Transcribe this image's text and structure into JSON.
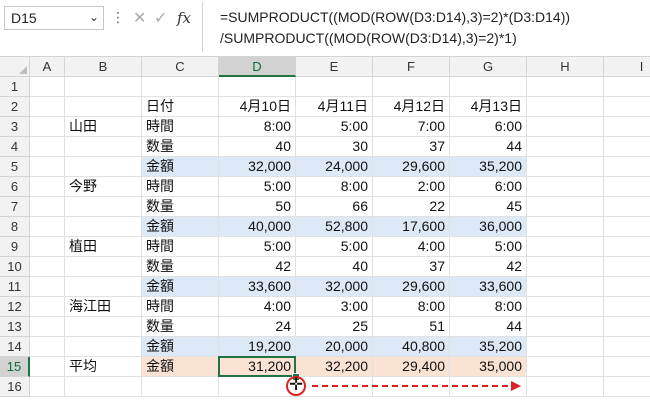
{
  "formula_bar": {
    "name_box": "D15",
    "name_box_chevron": "chevron-down-icon",
    "more_icon": "vertical-dots-icon",
    "cancel_icon": "close-icon",
    "enter_icon": "check-icon",
    "fx_label": "fx",
    "formula_line1": "=SUMPRODUCT((MOD(ROW(D3:D14),3)=2)*(D3:D14))",
    "formula_line2": "/SUMPRODUCT((MOD(ROW(D3:D14),3)=2)*1)"
  },
  "columns": [
    "A",
    "B",
    "C",
    "D",
    "E",
    "F",
    "G",
    "H",
    "I"
  ],
  "selected_column": "D",
  "rows": [
    "1",
    "2",
    "3",
    "4",
    "5",
    "6",
    "7",
    "8",
    "9",
    "10",
    "11",
    "12",
    "13",
    "14",
    "15",
    "16"
  ],
  "selected_row": "15",
  "cells": {
    "C2": "日付",
    "D2": "4月10日",
    "E2": "4月11日",
    "F2": "4月12日",
    "G2": "4月13日",
    "B3": "山田",
    "C3": "時間",
    "D3": "8:00",
    "E3": "5:00",
    "F3": "7:00",
    "G3": "6:00",
    "C4": "数量",
    "D4": "40",
    "E4": "30",
    "F4": "37",
    "G4": "44",
    "C5": "金額",
    "D5": "32,000",
    "E5": "24,000",
    "F5": "29,600",
    "G5": "35,200",
    "B6": "今野",
    "C6": "時間",
    "D6": "5:00",
    "E6": "8:00",
    "F6": "2:00",
    "G6": "6:00",
    "C7": "数量",
    "D7": "50",
    "E7": "66",
    "F7": "22",
    "G7": "45",
    "C8": "金額",
    "D8": "40,000",
    "E8": "52,800",
    "F8": "17,600",
    "G8": "36,000",
    "B9": "植田",
    "C9": "時間",
    "D9": "5:00",
    "E9": "5:00",
    "F9": "4:00",
    "G9": "5:00",
    "C10": "数量",
    "D10": "42",
    "E10": "40",
    "F10": "37",
    "G10": "42",
    "C11": "金額",
    "D11": "33,600",
    "E11": "32,000",
    "F11": "29,600",
    "G11": "33,600",
    "B12": "海江田",
    "C12": "時間",
    "D12": "4:00",
    "E12": "3:00",
    "F12": "8:00",
    "G12": "8:00",
    "C13": "数量",
    "D13": "24",
    "E13": "25",
    "F13": "51",
    "G13": "44",
    "C14": "金額",
    "D14": "19,200",
    "E14": "20,000",
    "F14": "40,800",
    "G14": "35,200",
    "B15": "平均",
    "C15": "金額",
    "D15": "31,200",
    "E15": "32,200",
    "F15": "29,400",
    "G15": "35,000"
  },
  "annotation": {
    "fill_cursor_icon": "plus-cursor-icon",
    "arrow_color": "#e02020"
  },
  "colors": {
    "selection_green": "#217346",
    "amount_row_blue": "#dde9f6",
    "average_row_peach": "#fbe3d4"
  }
}
